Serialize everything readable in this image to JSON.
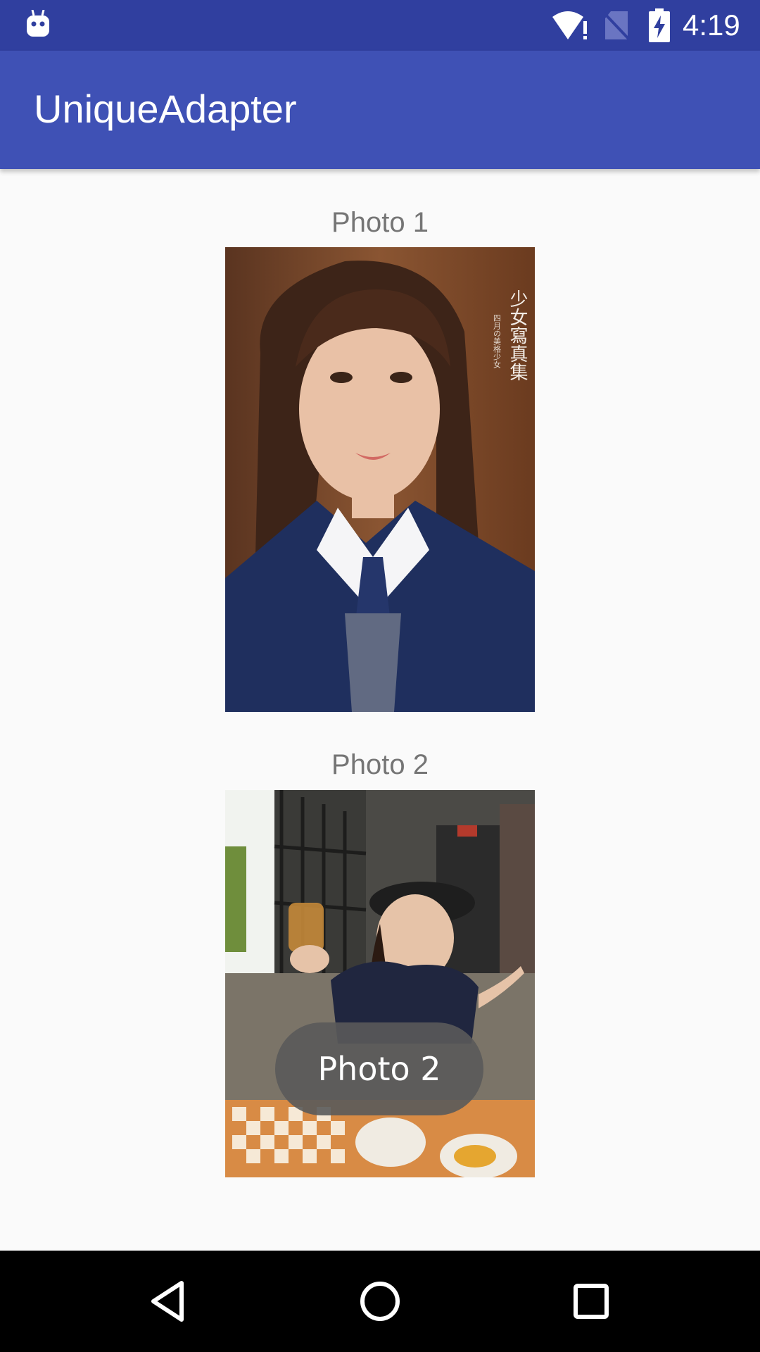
{
  "status_bar": {
    "time": "4:19",
    "icons": [
      "android-robot-icon",
      "wifi-alert-icon",
      "no-sim-icon",
      "battery-charging-icon"
    ]
  },
  "app_bar": {
    "title": "UniqueAdapter"
  },
  "list": {
    "items": [
      {
        "label": "Photo 1",
        "image": "portrait-photo"
      },
      {
        "label": "Photo 2",
        "image": "cafe-photo"
      }
    ]
  },
  "toast": {
    "text": "Photo 2"
  },
  "nav_bar": {
    "icons": [
      "back-icon",
      "home-icon",
      "recents-icon"
    ]
  },
  "colors": {
    "primary": "#3f51b5",
    "primary_dark": "#303f9f",
    "background": "#fafafa",
    "label": "#757575"
  }
}
